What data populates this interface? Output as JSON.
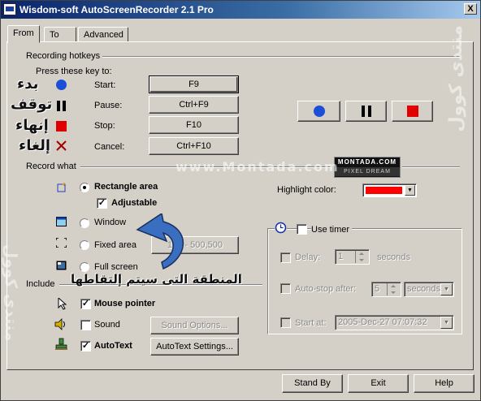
{
  "window": {
    "title": "Wisdom-soft AutoScreenRecorder 2.1 Pro",
    "close_glyph": "X"
  },
  "tabs": [
    {
      "label": "From",
      "active": true
    },
    {
      "label": "To"
    },
    {
      "label": "Advanced"
    }
  ],
  "hotkeys": {
    "section": "Recording hotkeys",
    "press_label": "Press these key to:",
    "rows": [
      {
        "label": "Start:",
        "key": "F9",
        "icon": "blue-circle-icon",
        "arabic": "بدء"
      },
      {
        "label": "Pause:",
        "key": "Ctrl+F9",
        "icon": "pause-icon",
        "arabic": "توقف"
      },
      {
        "label": "Stop:",
        "key": "F10",
        "icon": "red-square-icon",
        "arabic": "إنهاء"
      },
      {
        "label": "Cancel:",
        "key": "Ctrl+F10",
        "icon": "cancel-x-icon",
        "arabic": "إلغاء"
      }
    ]
  },
  "record_what": {
    "section": "Record what",
    "rectangle": "Rectangle area",
    "adjustable": "Adjustable",
    "window": "Window",
    "fixed": "Fixed area",
    "fixed_value": "100 - 500,500",
    "full": "Full screen",
    "selected": "rectangle"
  },
  "include": {
    "section": "Include",
    "mouse": "Mouse pointer",
    "sound": "Sound",
    "sound_options": "Sound Options...",
    "autotext": "AutoText",
    "autotext_settings": "AutoText Settings..."
  },
  "highlight": {
    "label": "Highlight color:",
    "color": "#ff0000"
  },
  "timer": {
    "use_timer": "Use timer",
    "delay_label": "Delay:",
    "delay_value": "1",
    "delay_unit": "seconds",
    "autostop_label": "Auto-stop after:",
    "autostop_value": "5",
    "autostop_unit": "seconds",
    "start_label": "Start at:",
    "start_value": "2005-Dec-27 07:07:32"
  },
  "footer": {
    "standby": "Stand By",
    "exit": "Exit",
    "help": "Help"
  },
  "overlay": {
    "arabic_caption": "المنطقة التى سيتم إلتقاطها",
    "watermark_site": "www.Montada.com",
    "logo_top": "MONTADA.COM",
    "logo_bottom": "PIXEL DREAM",
    "watermark_side": "منتدى كوول"
  },
  "colors": {
    "accent_blue": "#1c4fd8",
    "stop_red": "#e00000",
    "title_blue": "#0a246a"
  }
}
